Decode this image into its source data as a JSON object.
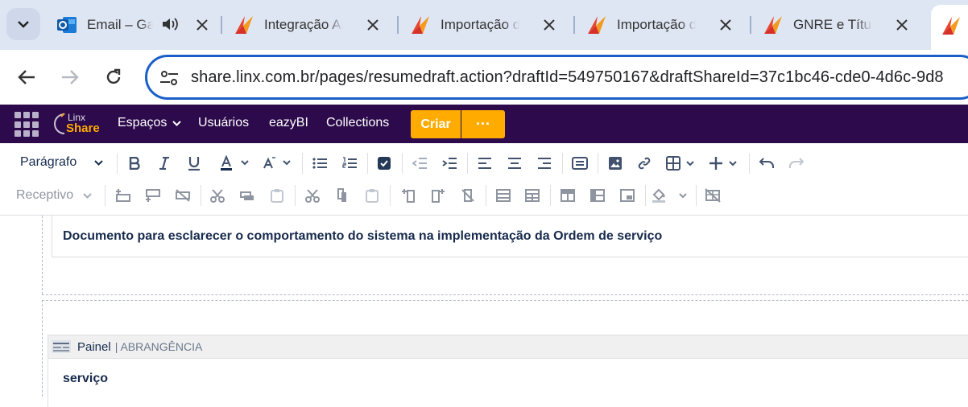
{
  "browser": {
    "tabs": [
      {
        "title": "Email – Ga",
        "favicon": "outlook-icon",
        "audio": true
      },
      {
        "title": "Integração AP",
        "favicon": "linx-icon"
      },
      {
        "title": "Importação de",
        "favicon": "linx-icon"
      },
      {
        "title": "Importação de",
        "favicon": "linx-icon"
      },
      {
        "title": "GNRE e Títulos",
        "favicon": "linx-icon"
      }
    ],
    "url": "share.linx.com.br/pages/resumedraft.action?draftId=549750167&draftShareId=37c1bc46-cde0-4d6c-9d8"
  },
  "confluence_nav": {
    "logo_top": "Linx",
    "logo_bottom": "Share",
    "items": [
      "Espaços",
      "Usuários",
      "eazyBI",
      "Collections"
    ],
    "create_label": "Criar",
    "more_label": "···"
  },
  "toolbar": {
    "paragraph_select": "Parágrafo",
    "table_style_select": "Receptivo"
  },
  "content": {
    "heading_text": "Documento para esclarecer o comportamento do sistema na implementação da Ordem de serviço",
    "panel_label": "Painel",
    "panel_title": "| ABRANGÊNCIA",
    "panel_body": "serviço"
  },
  "colors": {
    "tab_strip": "#dfe6f3",
    "omnibox_border": "#1a5fc8",
    "nav_bg": "#2c0a4b",
    "create_button": "#ffab00"
  }
}
